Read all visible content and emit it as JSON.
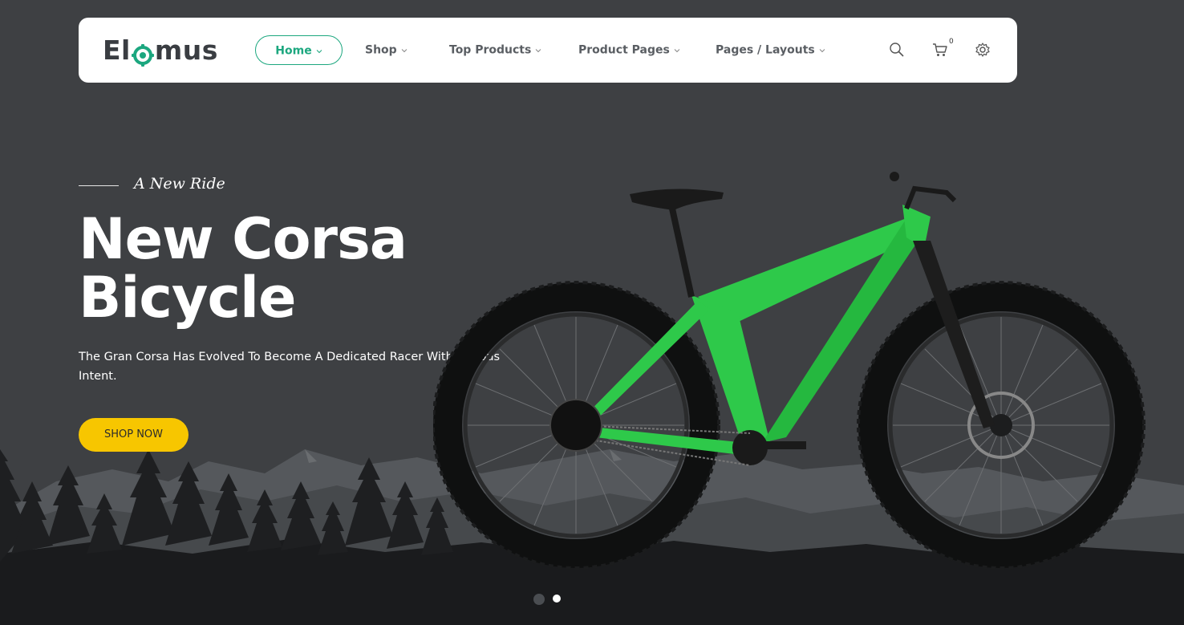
{
  "brand": {
    "logo_left": "El",
    "logo_right": "mus",
    "logo_icon": "gear-ring-icon",
    "accent_color": "#1ca77f"
  },
  "nav": {
    "items": [
      {
        "label": "Home",
        "active": true
      },
      {
        "label": "Shop",
        "active": false
      },
      {
        "label": "Top Products",
        "active": false
      },
      {
        "label": "Product Pages",
        "active": false
      },
      {
        "label": "Pages / Layouts",
        "active": false
      }
    ],
    "chevron_icon": "chevron-down-icon"
  },
  "header_actions": {
    "search_icon": "search-icon",
    "cart_icon": "cart-icon",
    "cart_count": "0",
    "settings_icon": "gear-icon"
  },
  "hero": {
    "eyebrow": "A New Ride",
    "title_line1": "New Corsa",
    "title_line2": "Bicycle",
    "description": "The Gran Corsa Has Evolved To Become A Dedicated Racer With Serious Intent.",
    "cta_label": "SHOP NOW",
    "cta_color": "#f7c600",
    "bike_color": "#2ec94a"
  },
  "slider": {
    "slide_count": 2,
    "active_index": 1
  }
}
